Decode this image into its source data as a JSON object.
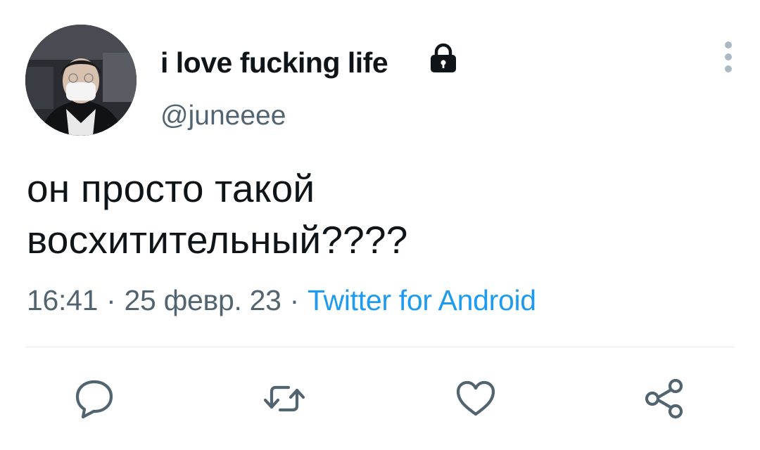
{
  "tweet": {
    "author": {
      "display_name": "i love fucking life",
      "handle": "@juneeee",
      "protected": true
    },
    "text_line1": "он просто такой",
    "text_line2": "восхитительный????",
    "time": "16:41",
    "date": "25 февр. 23",
    "separator": "·",
    "source": "Twitter for Android"
  },
  "actions": {
    "reply_icon": "speech-bubble-icon",
    "retweet_icon": "retweet-arrows-icon",
    "like_icon": "heart-outline-icon",
    "share_icon": "share-nodes-icon"
  },
  "colors": {
    "text": "#0f1419",
    "secondary_text": "#536471",
    "link": "#1d9bf0",
    "divider": "#e7ebed",
    "icon": "#536471"
  }
}
